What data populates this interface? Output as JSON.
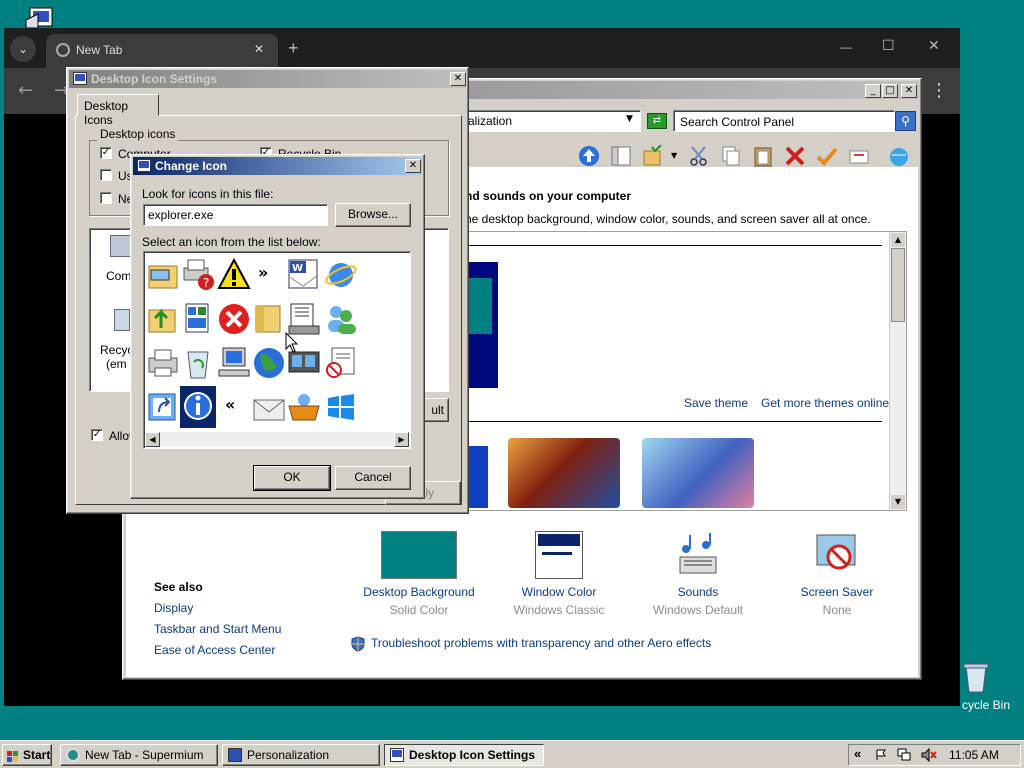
{
  "browser": {
    "tab_label": "New Tab",
    "tab_close": "✕",
    "new_tab": "+",
    "window_controls": {
      "minimize": "—",
      "maximize": "☐",
      "close": "✕"
    },
    "menu": "⋮"
  },
  "control_panel": {
    "address_text": "alization",
    "search_placeholder": "Search Control Panel",
    "heading": "nd sounds on your computer",
    "subheading": "he desktop background, window color, sounds, and screen saver all at once.",
    "save_theme": "Save theme",
    "get_more_themes": "Get more themes online",
    "see_also": {
      "title": "See also",
      "links": [
        "Display",
        "Taskbar and Start Menu",
        "Ease of Access Center"
      ]
    },
    "items": [
      {
        "label": "Desktop Background",
        "sub": "Solid Color"
      },
      {
        "label": "Window Color",
        "sub": "Windows Classic"
      },
      {
        "label": "Sounds",
        "sub": "Windows Default"
      },
      {
        "label": "Screen Saver",
        "sub": "None"
      }
    ],
    "troubleshoot": "Troubleshoot problems with transparency and other Aero effects",
    "colors": {
      "solid_color": "#008080",
      "link": "#0b3a8a"
    }
  },
  "desktop_icon_settings": {
    "title": "Desktop Icon Settings",
    "tab": "Desktop Icons",
    "group_label": "Desktop icons",
    "computer_cb": "Computer",
    "recycle_cb": "Recycle Bin",
    "user_cb": "Us",
    "network_cb": "Ne",
    "list_items": [
      "Comp",
      "Recyc",
      "(em"
    ],
    "default_btn": "ult",
    "allow_cb": "Allov",
    "apply_btn": "ply"
  },
  "change_icon": {
    "title": "Change Icon",
    "look_label": "Look for icons in this file:",
    "file_value": "explorer.exe",
    "browse_btn": "Browse...",
    "select_label": "Select an icon from the list below:",
    "ok_btn": "OK",
    "cancel_btn": "Cancel"
  },
  "desktop": {
    "recycle_label": "cycle Bin"
  },
  "taskbar": {
    "start": "Start",
    "items": [
      "New Tab - Supermium",
      "Personalization",
      "Desktop Icon Settings"
    ],
    "tray_expand": "«",
    "time": "11:05 AM"
  }
}
